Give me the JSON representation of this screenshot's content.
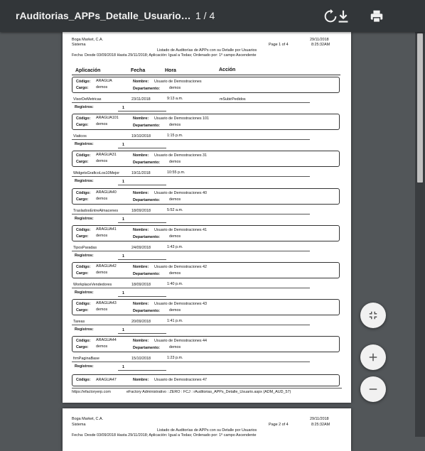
{
  "toolbar": {
    "title": "rAuditorias_APPs_Detalle_Usuario…",
    "page_indicator": "1 / 4"
  },
  "report": {
    "company": "Boga Market, C.A.",
    "system": "Sistema",
    "title": "Listado de Auditorías de APPs con su Detalle por Usuarios",
    "filter": "Fecha: Desde 03/09/2018  Hasta 29/11/2018; Aplicación: Igual a Todas; Ordenado por: 1º campo Ascendente",
    "date": "29/11/2018",
    "time": "8:25:32AM",
    "columns": [
      "Aplicación",
      "Fecha",
      "Hora",
      "Acción"
    ],
    "label_codigo": "Código:",
    "label_nombre": "Nombre:",
    "label_cargo": "Cargo:",
    "label_departamento": "Departamento:",
    "label_registros": "Registros:",
    "footer": {
      "url": "https://efactoryerp.com",
      "info": "eFactory Administrativo  :  ZERO  :  FCJ  :  rAuditorias_APPs_Detalle_Usuario.aspx (ADM_AUD_57)"
    }
  },
  "pages": [
    {
      "page_label": "Page 1 of 4",
      "records": [
        {
          "codigo": "ARAGUA",
          "nombre": "Usuario de Demostraciones",
          "cargo": "demos",
          "departamento": "demos",
          "app": "VisorDeMetricas",
          "fecha": "23/11/2018",
          "hora": "9:13 a.m.",
          "accion": "mSubirPedidos",
          "registros": "1"
        },
        {
          "codigo": "ARAGUA101",
          "nombre": "Usuario de Demostraciones 101",
          "cargo": "demos",
          "departamento": "demos",
          "app": "Viaticos",
          "fecha": "19/10/2018",
          "hora": "1:15 p.m.",
          "accion": "",
          "registros": "1"
        },
        {
          "codigo": "ARAGUA31",
          "nombre": "Usuario de Demostraciones 31",
          "cargo": "demos",
          "departamento": "demos",
          "app": "WidgetsGraficoLos10Mejor",
          "fecha": "19/11/2018",
          "hora": "10:55 p.m.",
          "accion": "",
          "registros": "1"
        },
        {
          "codigo": "ARAGUA40",
          "nombre": "Usuario de Demostraciones 40",
          "cargo": "demos",
          "departamento": "demos",
          "app": "TrasladosEntreAlmacenes",
          "fecha": "18/09/2018",
          "hora": "5:52 a.m.",
          "accion": "",
          "registros": "1"
        },
        {
          "codigo": "ARAGUA41",
          "nombre": "Usuario de Demostraciones 41",
          "cargo": "demos",
          "departamento": "demos",
          "app": "TiposParadas",
          "fecha": "24/09/2018",
          "hora": "1:43 p.m.",
          "accion": "",
          "registros": "1"
        },
        {
          "codigo": "ARAGUA42",
          "nombre": "Usuario de Demostraciones 42",
          "cargo": "demos",
          "departamento": "demos",
          "app": "WorkplaceVendedores",
          "fecha": "18/09/2018",
          "hora": "1:40 p.m.",
          "accion": "",
          "registros": "1"
        },
        {
          "codigo": "ARAGUA43",
          "nombre": "Usuario de Demostraciones 43",
          "cargo": "demos",
          "departamento": "demos",
          "app": "Tareas",
          "fecha": "20/09/2018",
          "hora": "1:41 p.m.",
          "accion": "",
          "registros": "1"
        },
        {
          "codigo": "ARAGUA44",
          "nombre": "Usuario de Demostraciones 44",
          "cargo": "demos",
          "departamento": "demos",
          "app": "frmPaginaBase",
          "fecha": "15/10/2018",
          "hora": "1:23 p.m.",
          "accion": "",
          "registros": "1"
        }
      ],
      "last_box": {
        "codigo": "ARAGUA47",
        "nombre": "Usuario de Demostraciones 47"
      }
    },
    {
      "page_label": "Page 2 of 4"
    }
  ],
  "icons": {
    "rotate": "rotate-icon",
    "download": "download-icon",
    "print": "print-icon",
    "fit": "fit-page-icon",
    "zoom_in": "plus-icon",
    "zoom_out": "minus-icon"
  }
}
